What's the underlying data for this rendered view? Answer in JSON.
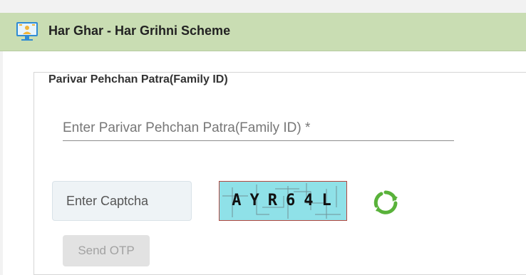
{
  "header": {
    "title": "Har Ghar - Har Grihni Scheme",
    "icon": "monitor-user-icon"
  },
  "family_section": {
    "legend": "Parivar Pehchan Patra(Family ID)",
    "family_id_placeholder": "Enter Parivar Pehchan Patra(Family ID) *",
    "family_id_value": ""
  },
  "captcha": {
    "input_placeholder": "Enter Captcha",
    "input_value": "",
    "image_text": "AYR64L",
    "refresh_icon": "refresh-icon"
  },
  "actions": {
    "send_otp_label": "Send OTP"
  },
  "colors": {
    "header_bg": "#c9ddb3",
    "captcha_bg": "#8fe1e8",
    "refresh_green": "#59b23a",
    "disabled_button_bg": "#e2e2e2"
  }
}
